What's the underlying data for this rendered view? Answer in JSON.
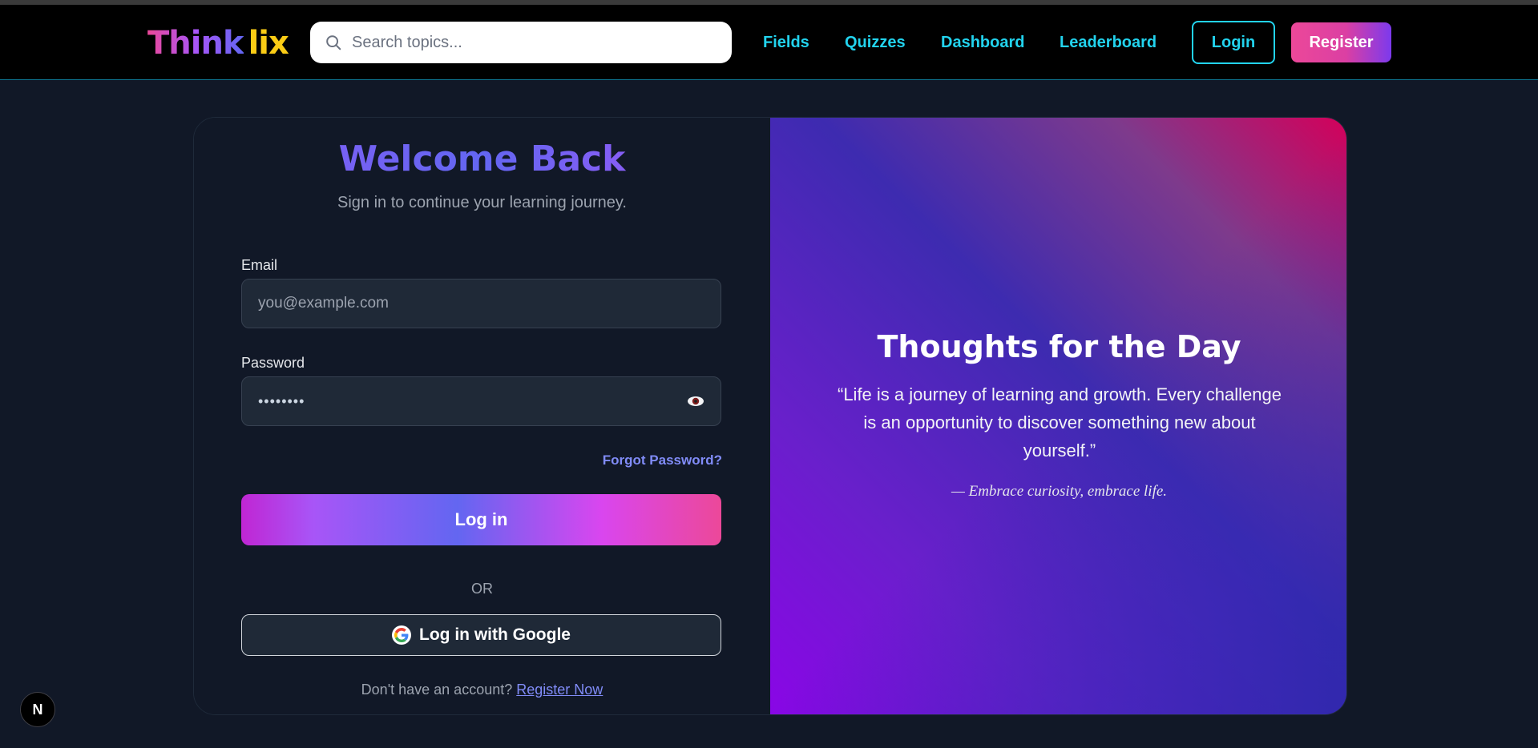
{
  "navbar": {
    "logo_part1": "Think",
    "logo_part2": "lix",
    "search_placeholder": "Search topics...",
    "links": [
      "Fields",
      "Quizzes",
      "Dashboard",
      "Leaderboard"
    ],
    "login_label": "Login",
    "register_label": "Register"
  },
  "login": {
    "title": "Welcome Back",
    "subtitle": "Sign in to continue your learning journey.",
    "email_label": "Email",
    "email_placeholder": "you@example.com",
    "password_label": "Password",
    "password_value": "••••••••",
    "forgot_label": "Forgot Password?",
    "submit_label": "Log in",
    "or_label": "OR",
    "google_label": "Log in with Google",
    "no_account_text": "Don't have an account?",
    "register_link": "Register Now"
  },
  "thoughts": {
    "title": "Thoughts for the Day",
    "quote": "“Life is a journey of learning and growth. Every challenge is an opportunity to discover something new about yourself.”",
    "attribution": "— Embrace curiosity, embrace life."
  },
  "badge": {
    "letter": "N"
  },
  "colors": {
    "accent_cyan": "#22d3ee",
    "accent_pink": "#ec4899",
    "accent_indigo": "#818cf8",
    "background": "#111827"
  }
}
